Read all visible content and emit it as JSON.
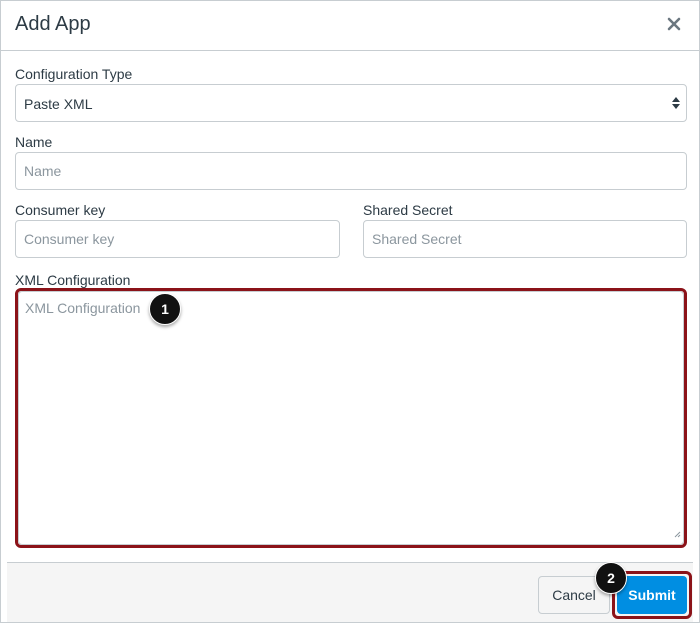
{
  "dialog": {
    "title": "Add App",
    "close_icon": "close-icon"
  },
  "form": {
    "configuration_type": {
      "label": "Configuration Type",
      "value": "Paste XML"
    },
    "name": {
      "label": "Name",
      "placeholder": "Name",
      "value": ""
    },
    "consumer_key": {
      "label": "Consumer key",
      "placeholder": "Consumer key",
      "value": ""
    },
    "shared_secret": {
      "label": "Shared Secret",
      "placeholder": "Shared Secret",
      "value": ""
    },
    "xml_configuration": {
      "label": "XML Configuration",
      "placeholder": "XML Configuration",
      "value": ""
    }
  },
  "annotations": {
    "step1": "1",
    "step2": "2",
    "highlight_color": "#8b1319"
  },
  "footer": {
    "cancel_label": "Cancel",
    "submit_label": "Submit",
    "submit_color": "#008ee2"
  }
}
